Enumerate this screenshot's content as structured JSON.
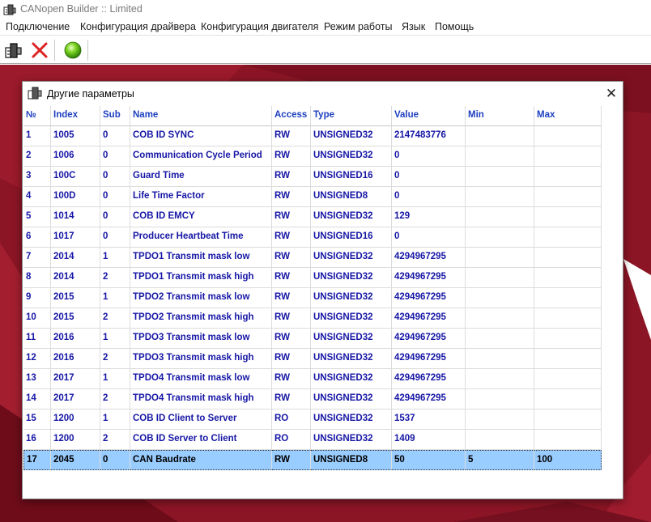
{
  "app": {
    "title": "CANopen Builder :: Limited",
    "icon": "app-icon"
  },
  "menu": [
    {
      "label": "Подключение"
    },
    {
      "label": "Конфигурация драйвера"
    },
    {
      "label": "Конфигурация двигателя"
    },
    {
      "label": "Режим работы"
    },
    {
      "label": "Язык"
    },
    {
      "label": "Помощь"
    }
  ],
  "toolbar": {
    "buttons": [
      {
        "icon": "connect-icon"
      },
      {
        "icon": "disconnect-icon"
      },
      {
        "icon": "status-green-light-icon"
      }
    ]
  },
  "colors": {
    "desktop_background": "#8c1525",
    "header_text": "#1e3fbf",
    "row_text": "#1616a6",
    "selected_row_background": "#99ccff"
  },
  "dialog": {
    "title": "Другие параметры",
    "close_label": "✕",
    "columns": [
      "№",
      "Index",
      "Sub",
      "Name",
      "Access",
      "Type",
      "Value",
      "Min",
      "Max"
    ],
    "rows": [
      [
        "1",
        "1005",
        "0",
        "COB ID SYNC",
        "RW",
        "UNSIGNED32",
        "2147483776",
        "",
        ""
      ],
      [
        "2",
        "1006",
        "0",
        "Communication Cycle Period",
        "RW",
        "UNSIGNED32",
        "0",
        "",
        ""
      ],
      [
        "3",
        "100C",
        "0",
        "Guard Time",
        "RW",
        "UNSIGNED16",
        "0",
        "",
        ""
      ],
      [
        "4",
        "100D",
        "0",
        "Life Time Factor",
        "RW",
        "UNSIGNED8",
        "0",
        "",
        ""
      ],
      [
        "5",
        "1014",
        "0",
        "COB ID EMCY",
        "RW",
        "UNSIGNED32",
        "129",
        "",
        ""
      ],
      [
        "6",
        "1017",
        "0",
        "Producer Heartbeat Time",
        "RW",
        "UNSIGNED16",
        "0",
        "",
        ""
      ],
      [
        "7",
        "2014",
        "1",
        "TPDO1 Transmit mask low",
        "RW",
        "UNSIGNED32",
        "4294967295",
        "",
        ""
      ],
      [
        "8",
        "2014",
        "2",
        "TPDO1 Transmit mask high",
        "RW",
        "UNSIGNED32",
        "4294967295",
        "",
        ""
      ],
      [
        "9",
        "2015",
        "1",
        "TPDO2 Transmit mask low",
        "RW",
        "UNSIGNED32",
        "4294967295",
        "",
        ""
      ],
      [
        "10",
        "2015",
        "2",
        "TPDO2 Transmit mask high",
        "RW",
        "UNSIGNED32",
        "4294967295",
        "",
        ""
      ],
      [
        "11",
        "2016",
        "1",
        "TPDO3 Transmit mask low",
        "RW",
        "UNSIGNED32",
        "4294967295",
        "",
        ""
      ],
      [
        "12",
        "2016",
        "2",
        "TPDO3 Transmit mask high",
        "RW",
        "UNSIGNED32",
        "4294967295",
        "",
        ""
      ],
      [
        "13",
        "2017",
        "1",
        "TPDO4 Transmit mask low",
        "RW",
        "UNSIGNED32",
        "4294967295",
        "",
        ""
      ],
      [
        "14",
        "2017",
        "2",
        "TPDO4 Transmit mask high",
        "RW",
        "UNSIGNED32",
        "4294967295",
        "",
        ""
      ],
      [
        "15",
        "1200",
        "1",
        "COB ID Client to Server",
        "RO",
        "UNSIGNED32",
        "1537",
        "",
        ""
      ],
      [
        "16",
        "1200",
        "2",
        "COB ID Server to Client",
        "RO",
        "UNSIGNED32",
        "1409",
        "",
        ""
      ],
      [
        "17",
        "2045",
        "0",
        "CAN Baudrate",
        "RW",
        "UNSIGNED8",
        "50",
        "5",
        "100"
      ]
    ],
    "selected_row": 16
  }
}
